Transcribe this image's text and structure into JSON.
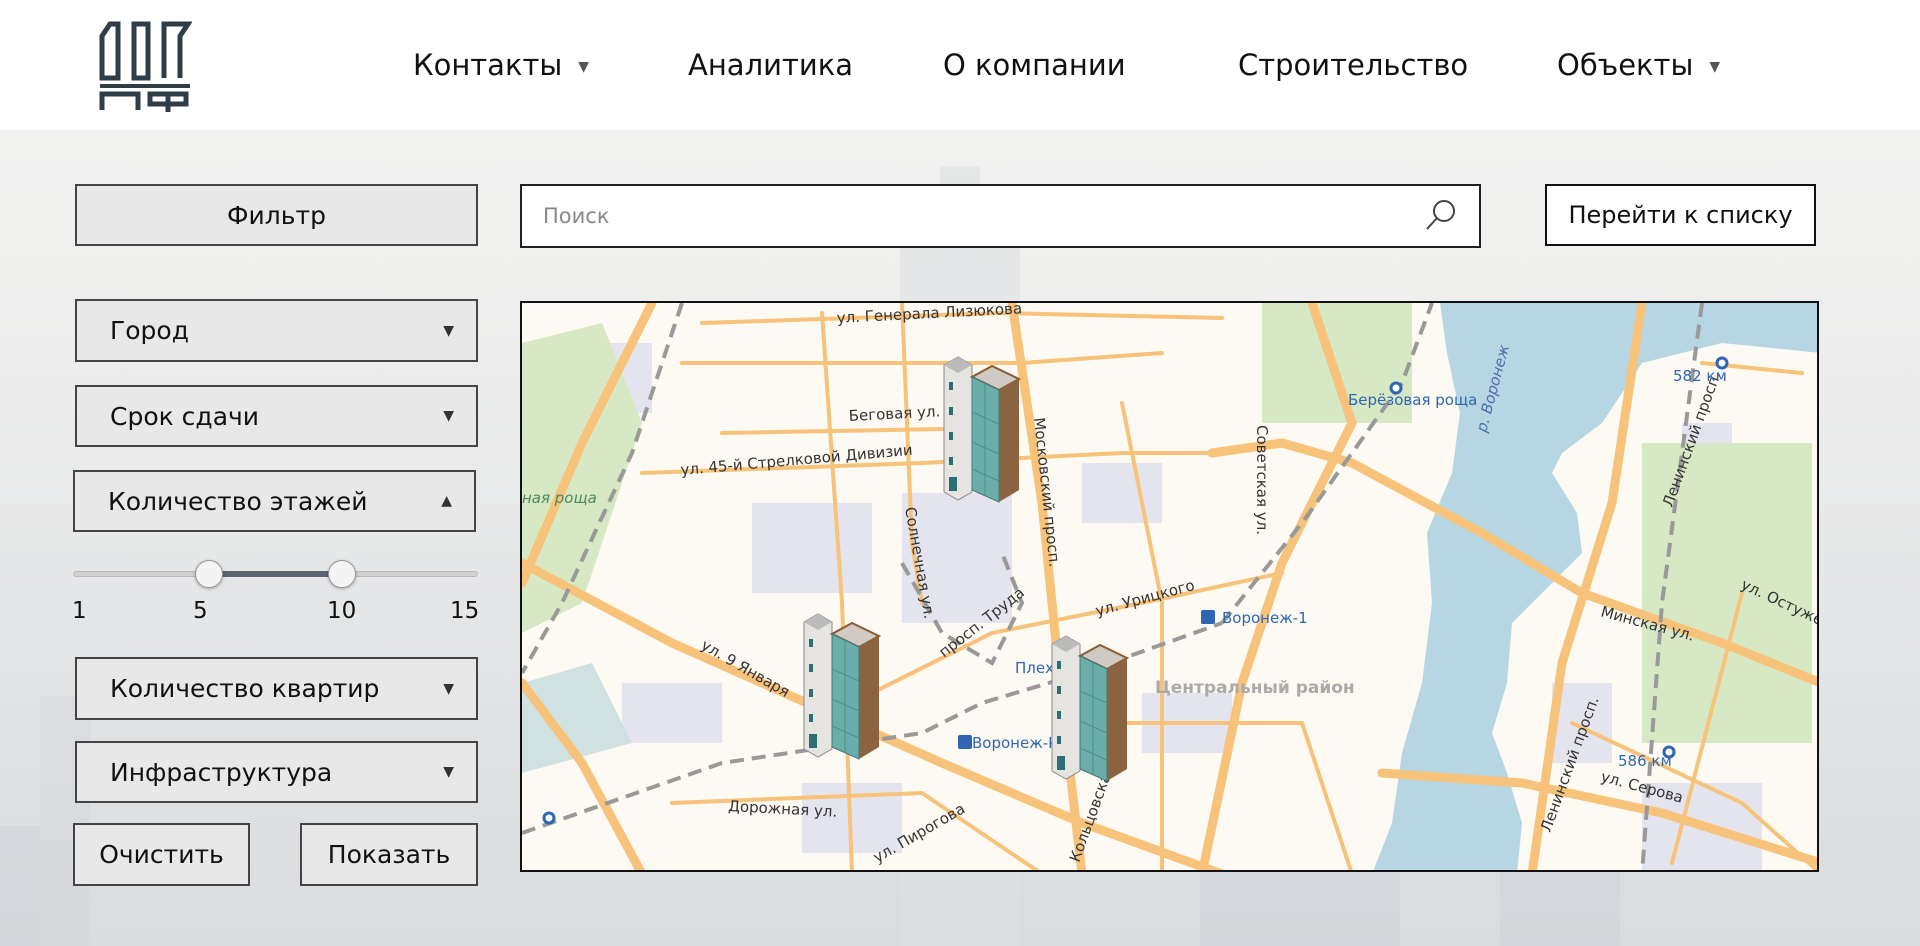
{
  "header": {
    "logo_text": "ДОМ РФ",
    "nav": [
      {
        "label": "Контакты",
        "has_dropdown": true
      },
      {
        "label": "Аналитика",
        "has_dropdown": false
      },
      {
        "label": "О компании",
        "has_dropdown": false
      },
      {
        "label": "Строительство",
        "has_dropdown": false
      },
      {
        "label": "Объекты",
        "has_dropdown": true
      }
    ]
  },
  "toolbar": {
    "filter_label": "Фильтр",
    "search_placeholder": "Поиск",
    "search_value": "",
    "list_label": "Перейти к списку"
  },
  "filters": {
    "city": "Город",
    "deadline": "Срок сдачи",
    "floors": "Количество этажей",
    "apartments": "Количество квартир",
    "infrastructure": "Инфраструктура",
    "floors_slider": {
      "min": 1,
      "max": 15,
      "low": 5,
      "high": 10,
      "ticks": [
        "1",
        "5",
        "10",
        "15"
      ]
    },
    "clear_label": "Очистить",
    "show_label": "Показать"
  },
  "map": {
    "labels": [
      "ул. Генерала Лизюкова",
      "Беговая ул.",
      "ул. 45-й Стрелковой Дивизии",
      "Московский просп.",
      "Солнечная ул.",
      "просп. Труда",
      "ул. Урицкого",
      "ул. 9 Января",
      "Центральный район",
      "Дорожная ул.",
      "ул. Пирогова",
      "Кольцовская ул.",
      "Советская ул.",
      "р. Воронеж",
      "Ленинский просп.",
      "ул. Остужева",
      "Минская ул.",
      "ул. Серова",
      "ная роща"
    ],
    "stations": [
      "Воронеж-1",
      "Воронеж-Ку",
      "Плеха",
      "Берёзовая роща",
      "582 км",
      "586 км"
    ],
    "markers": 3,
    "colors": {
      "land": "#fcfaf2",
      "road": "#f7c27a",
      "water": "#b7d6e4",
      "park": "#d7e9c4",
      "block": "#e4e4ee"
    }
  }
}
